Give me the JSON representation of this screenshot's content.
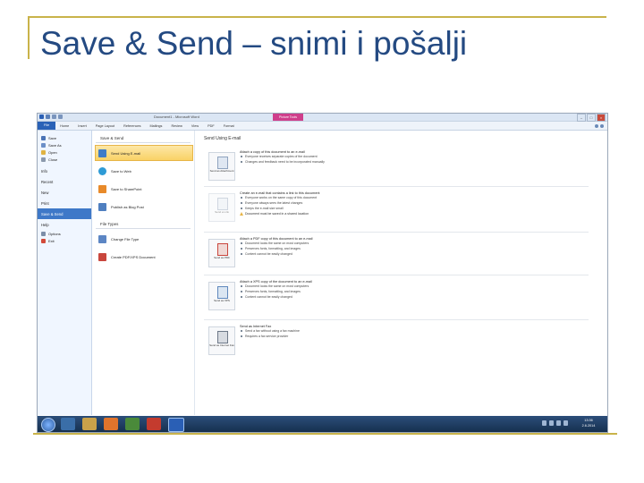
{
  "slide": {
    "title": "Save & Send – snimi i pošalji",
    "accent_color": "#c9b34a",
    "title_color": "#244a82"
  },
  "window": {
    "title": "Document1 - Microsoft Word",
    "context_tab": "Picture Tools",
    "buttons": [
      "–",
      "□",
      "×"
    ]
  },
  "ribbon": {
    "tabs": [
      "File",
      "Home",
      "Insert",
      "Page Layout",
      "References",
      "Mailings",
      "Review",
      "View",
      "PDF",
      "Format"
    ]
  },
  "nav": {
    "items": [
      {
        "label": "Save",
        "icon": "save-icon"
      },
      {
        "label": "Save As",
        "icon": "save-as-icon"
      },
      {
        "label": "Open",
        "icon": "open-folder-icon"
      },
      {
        "label": "Close",
        "icon": "close-document-icon"
      }
    ],
    "headers": [
      "Info",
      "Recent",
      "New",
      "Print",
      "Save & Send",
      "Help"
    ],
    "active": "Save & Send",
    "bottom": [
      {
        "label": "Options",
        "icon": "options-icon"
      },
      {
        "label": "Exit",
        "icon": "exit-icon"
      }
    ]
  },
  "options": {
    "section1": "Save & Send",
    "section2": "File Types",
    "send_items": [
      "Send Using E-mail",
      "Save to Web",
      "Save to SharePoint",
      "Publish as Blog Post"
    ],
    "file_items": [
      "Change File Type",
      "Create PDF/XPS Document"
    ]
  },
  "detail": {
    "title": "Send Using E-mail",
    "blocks": [
      {
        "button": "Send as Attachment",
        "lead": "Attach a copy of this document to an e-mail",
        "bullets": [
          "Everyone receives separate copies of the document",
          "Changes and feedback need to be incorporated manually"
        ]
      },
      {
        "button": "Send a Link",
        "lead": "Create an e-mail that contains a link to this document",
        "bullets": [
          "Everyone works on the same copy of this document",
          "Everyone always sees the latest changes",
          "Keeps the e-mail size small"
        ],
        "warning": "Document must be saved in a shared location"
      },
      {
        "button": "Send as PDF",
        "lead": "Attach a PDF copy of this document to an e-mail",
        "bullets": [
          "Document looks the same on most computers",
          "Preserves fonts, formatting, and images",
          "Content cannot be easily changed"
        ]
      },
      {
        "button": "Send as XPS",
        "lead": "Attach a XPS copy of the document to an e-mail",
        "bullets": [
          "Document looks the same on most computers",
          "Preserves fonts, formatting, and images",
          "Content cannot be easily changed"
        ]
      },
      {
        "button": "Send as Internet Fax",
        "lead": "Send as Internet Fax",
        "bullets": [
          "Send a fax without using a fax machine",
          "Requires a fax service provider"
        ]
      }
    ]
  },
  "taskbar": {
    "clock_time": "13:36",
    "clock_date": "2.6.2014"
  }
}
